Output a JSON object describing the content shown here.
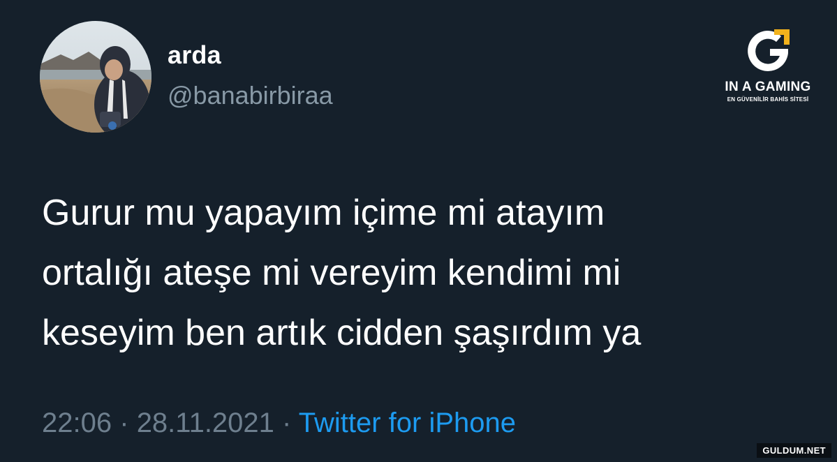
{
  "tweet": {
    "display_name": "arda",
    "handle": "@banabirbiraa",
    "avatar_icon": "profile-photo",
    "text_lines": [
      "Gurur mu yapayım içime mi atayım",
      "ortalığı ateşe mi vereyim kendimi mi",
      "keseyim ben artık cidden şaşırdım ya"
    ],
    "time": "22:06",
    "separator": "·",
    "date": "28.11.2021",
    "source": "Twitter for iPhone"
  },
  "brand_overlay": {
    "name": "IN A GAMING",
    "tagline": "EN GÜVENİLİR BAHİS SİTESİ",
    "logo_icon": "g-logo-icon",
    "accent_color": "#f2b21c"
  },
  "watermark": {
    "text": "GULDUM.NET"
  },
  "colors": {
    "background": "#15202b",
    "primary_text": "#ffffff",
    "secondary_text": "#8899a6",
    "link": "#1d9bf0"
  }
}
